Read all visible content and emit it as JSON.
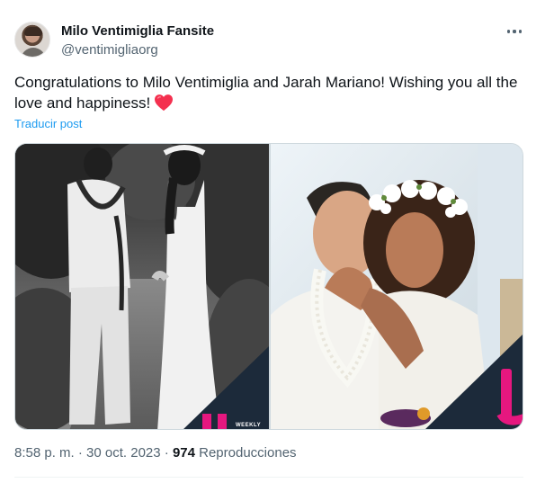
{
  "author": {
    "display_name": "Milo Ventimiglia Fansite",
    "handle": "@ventimigliaorg"
  },
  "post": {
    "text": "Congratulations to Milo Ventimiglia and Jarah Mariano! Wishing you all the love and happiness!",
    "emoji": "red-heart-icon",
    "translate_label": "Traducir post"
  },
  "media": {
    "left_photo_label": "WEEKLY",
    "brand_colors": {
      "navy": "#1c2a3a",
      "magenta": "#e6177f"
    }
  },
  "meta": {
    "timestamp": "8:58 p. m. · 30 oct. 2023 · ",
    "views_count": "974",
    "views_label": " Reproducciones"
  },
  "colors": {
    "text": "#0f1419",
    "secondary": "#536471",
    "link": "#1d9bf0",
    "heart": "#f91880"
  }
}
